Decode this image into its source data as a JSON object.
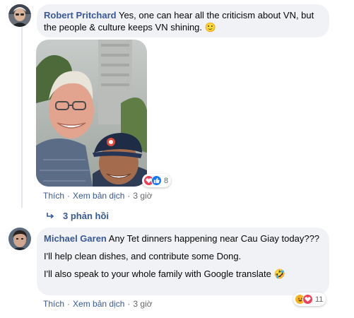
{
  "comment1": {
    "author": "Robert Pritchard",
    "text": "Yes, one can hear all the criticism about VN, but the people & culture keeps VN shining.",
    "emoji": "🙂",
    "reaction_count": "8",
    "actions": {
      "like": "Thích",
      "translate": "Xem bản dịch",
      "time": "3 giờ"
    },
    "replies_label": "3 phản hồi"
  },
  "comment2": {
    "author": "Michael Garen",
    "line1": "Any Tet dinners happening near Cau Giay today???",
    "line2": "I'll help clean dishes, and contribute some Dong.",
    "line3": "I'll also speak to your whole family with Google translate",
    "emoji": "🤣",
    "reaction_count": "11",
    "actions": {
      "like": "Thích",
      "translate": "Xem bản dịch",
      "time": "3 giờ"
    }
  },
  "colors": {
    "link": "#385898",
    "bubble": "#f0f2f5",
    "muted": "#65676b"
  },
  "icons": {
    "reply_arrow": "reply-arrow-icon",
    "love": "heart-icon",
    "like": "thumbs-up-icon",
    "haha": "laugh-icon"
  }
}
